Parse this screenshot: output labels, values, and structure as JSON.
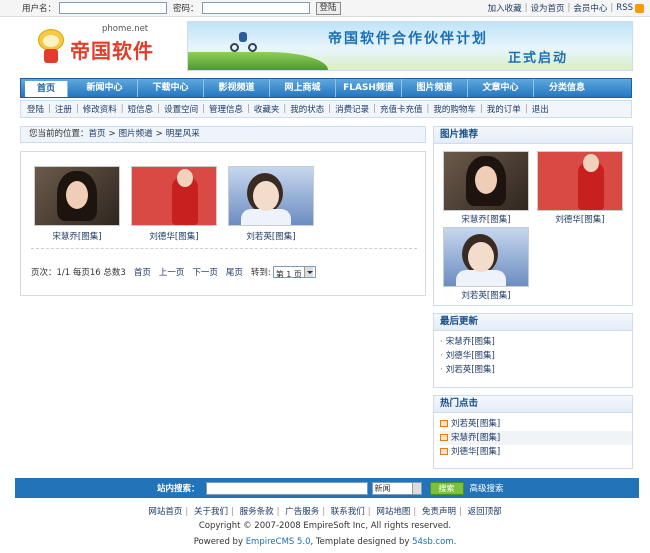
{
  "topbar": {
    "username_label": "用户名：",
    "password_label": "密码：",
    "login_button": "登陆",
    "links": [
      "加入收藏",
      "设为首页",
      "会员中心",
      "RSS"
    ]
  },
  "header": {
    "logo_domain": "phome.net",
    "logo_name": "帝国软件",
    "banner_title": "帝国软件合作伙伴计划",
    "banner_subtitle": "正式启动"
  },
  "nav": {
    "items": [
      "首页",
      "新闻中心",
      "下载中心",
      "影视频道",
      "网上商城",
      "FLASH频道",
      "图片频道",
      "文章中心",
      "分类信息"
    ]
  },
  "subnav": {
    "items": [
      "登陆",
      "注册",
      "修改资料",
      "短信息",
      "设置空间",
      "管理信息",
      "收藏夹",
      "我的状态",
      "消费记录",
      "充值卡充值",
      "我的购物车",
      "我的订单",
      "退出"
    ]
  },
  "breadcrumb": {
    "prefix": "您当前的位置：",
    "items": [
      "首页",
      "图片频道",
      "明星风采"
    ],
    "sep": ">"
  },
  "gallery": {
    "items": [
      {
        "caption": "宋慧乔[图集]"
      },
      {
        "caption": "刘德华[图集]"
      },
      {
        "caption": "刘若英[图集]"
      }
    ]
  },
  "pager": {
    "info": "页次：1/1 每页16 总数3",
    "first": "首页",
    "prev": "上一页",
    "next": "下一页",
    "last": "尾页",
    "goto_label": "转到:",
    "page_select": "第 1 页"
  },
  "sidebar": {
    "recommend": {
      "title": "图片推荐",
      "items": [
        {
          "caption": "宋慧乔[图集]"
        },
        {
          "caption": "刘德华[图集]"
        },
        {
          "caption": "刘若英[图集]"
        }
      ]
    },
    "latest": {
      "title": "最后更新",
      "items": [
        "宋慧乔[图集]",
        "刘德华[图集]",
        "刘若英[图集]"
      ]
    },
    "hot": {
      "title": "热门点击",
      "items": [
        "刘若英[图集]",
        "宋慧乔[图集]",
        "刘德华[图集]"
      ]
    }
  },
  "footer": {
    "search_label": "站内搜索：",
    "search_select": "新闻",
    "search_button": "搜索",
    "advanced": "高级搜索",
    "links": [
      "网站首页",
      "关于我们",
      "服务条款",
      "广告服务",
      "联系我们",
      "网站地图",
      "免责声明",
      "返回顶部"
    ],
    "copyright": "Copyright © 2007-2008 EmpireSoft Inc, All rights reserved.",
    "powered_prefix": "Powered by ",
    "powered_name": "EmpireCMS 5.0",
    "powered_mid": ", Template designed by ",
    "powered_site": "54sb.com",
    "powered_end": "."
  },
  "colors": {
    "nav_blue": "#2576c0",
    "logo_red": "#e23d2b",
    "link_blue": "#1f3a66"
  }
}
